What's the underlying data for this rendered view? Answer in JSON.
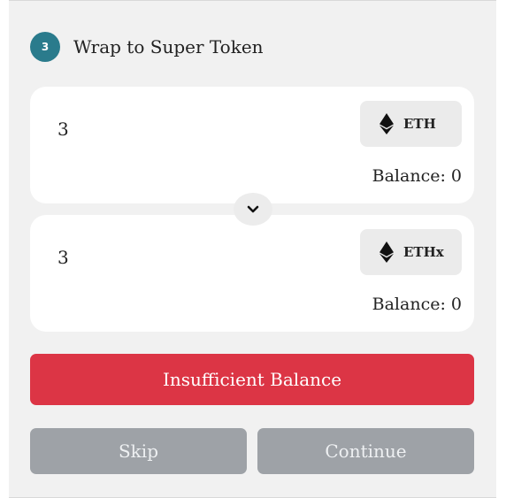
{
  "step": {
    "number": "3",
    "title": "Wrap to Super Token"
  },
  "from_token": {
    "amount": "3",
    "symbol": "ETH",
    "balance": "Balance: 0",
    "icon": "ethereum-icon"
  },
  "to_token": {
    "amount": "3",
    "symbol": "ETHx",
    "balance": "Balance: 0",
    "icon": "ethereum-icon"
  },
  "swap_toggle_icon": "chevron-down-icon",
  "buttons": {
    "insufficient": "Insufficient Balance",
    "skip": "Skip",
    "continue": "Continue"
  },
  "colors": {
    "step_badge": "#2a7b8c",
    "danger": "#dc3545",
    "disabled": "#9ea2a7",
    "panel_bg": "#f1f1f1"
  }
}
